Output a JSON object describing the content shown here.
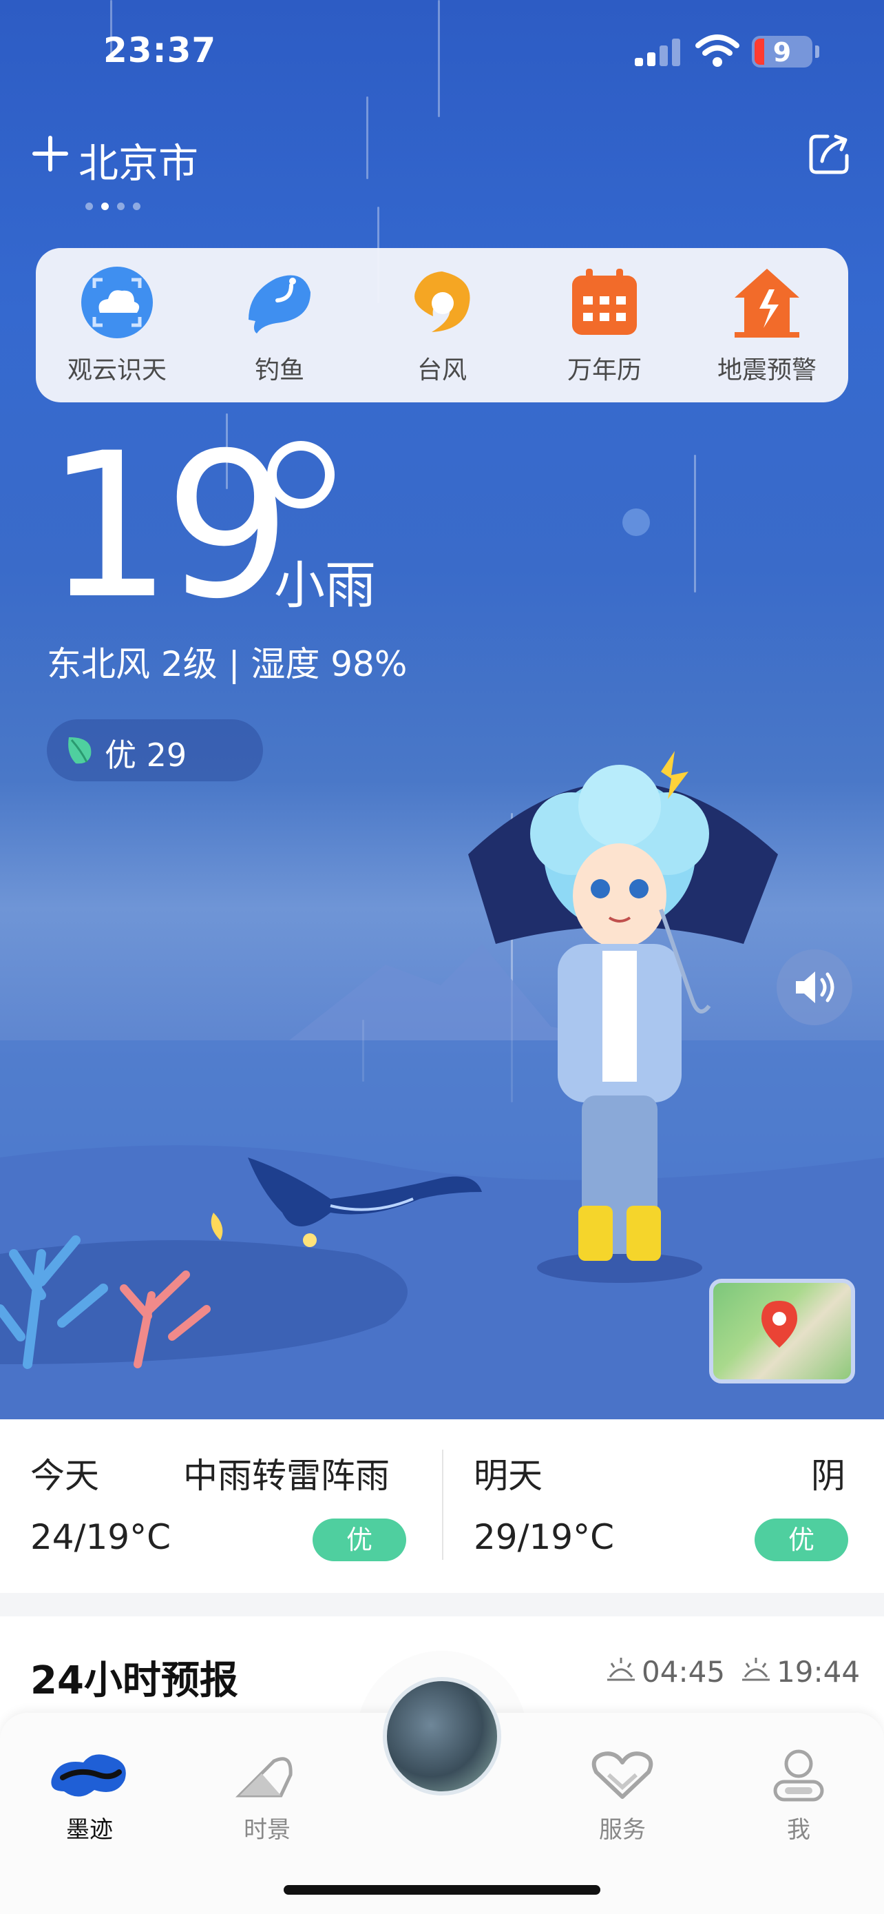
{
  "status_bar": {
    "time": "23:37",
    "battery": "9"
  },
  "header": {
    "city": "北京市",
    "add_icon": "plus-icon",
    "share_icon": "share-icon",
    "pages": 4,
    "active_page": 1
  },
  "tools": [
    {
      "label": "观云识天",
      "icon": "cloud-scan-icon"
    },
    {
      "label": "钓鱼",
      "icon": "fish-icon"
    },
    {
      "label": "台风",
      "icon": "typhoon-icon"
    },
    {
      "label": "万年历",
      "icon": "calendar-icon"
    },
    {
      "label": "地震预警",
      "icon": "earthquake-house-icon"
    }
  ],
  "current": {
    "temperature": "19",
    "condition": "小雨",
    "wind_humidity": "东北风 2级 | 湿度 98%",
    "aqi": "优 29"
  },
  "forecast": {
    "today": {
      "day": "今天",
      "condition": "中雨转雷阵雨",
      "temp": "24/19°C",
      "aqi": "优"
    },
    "tomorrow": {
      "day": "明天",
      "condition": "阴",
      "temp": "29/19°C",
      "aqi": "优"
    }
  },
  "hourly": {
    "title": "24小时预报",
    "sunrise": "04:45",
    "sunset": "19:44"
  },
  "tab_bar": [
    {
      "label": "墨迹",
      "active": true
    },
    {
      "label": "时景",
      "active": false
    },
    {
      "label": "服务",
      "active": false
    },
    {
      "label": "我",
      "active": false
    }
  ],
  "colors": {
    "sky_top": "#2d5cc4",
    "aqi_green": "#4fcf9f",
    "tool_orange": "#f26b2a",
    "tool_blue": "#3f8ff0"
  }
}
